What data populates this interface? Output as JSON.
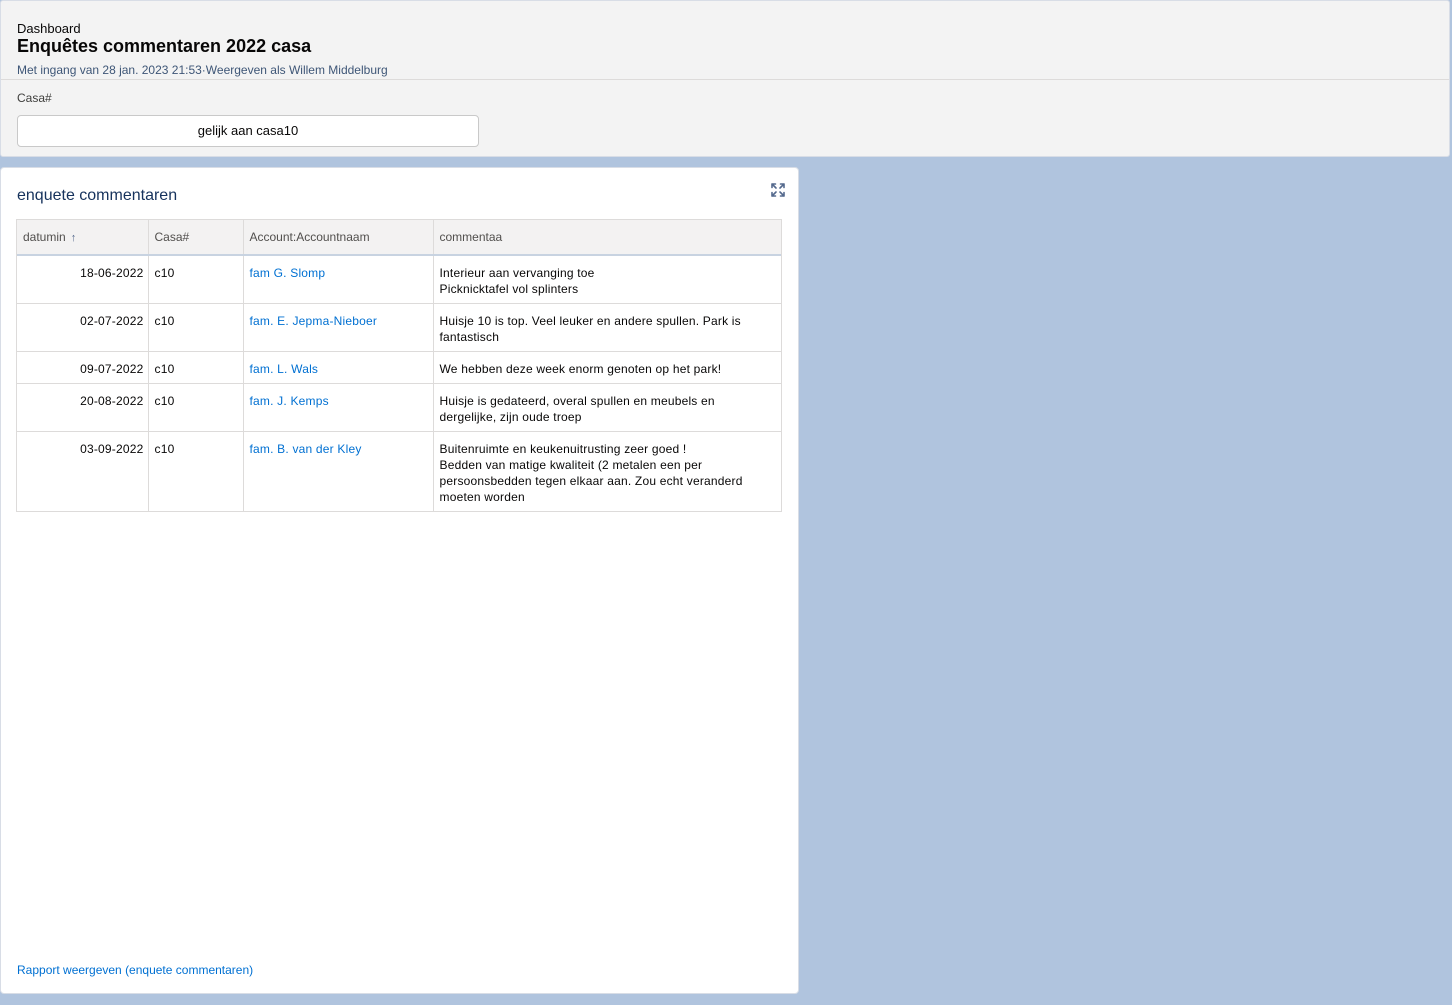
{
  "header": {
    "breadcrumb": "Dashboard",
    "title": "Enquêtes commentaren 2022 casa",
    "subtitle": "Met ingang van 28 jan. 2023 21:53·Weergeven als Willem Middelburg",
    "filter_label": "Casa#",
    "filter_value": "gelijk aan casa10"
  },
  "card": {
    "title": "enquete commentaren",
    "expand_icon": "expand-icon",
    "columns": [
      "datumin",
      "Casa#",
      "Account:Accountnaam",
      "commentaa"
    ],
    "sort_indicator": "↑",
    "rows": [
      {
        "date": "18-06-2022",
        "casa": "c10",
        "account": "fam G. Slomp",
        "comment_lines": [
          "Interieur aan vervanging toe",
          "Picknicktafel vol splinters"
        ]
      },
      {
        "date": "02-07-2022",
        "casa": "c10",
        "account": "fam. E. Jepma-Nieboer",
        "comment_lines": [
          "Huisje 10 is top. Veel leuker en andere spullen. Park is",
          "fantastisch"
        ]
      },
      {
        "date": "09-07-2022",
        "casa": "c10",
        "account": "fam. L. Wals",
        "comment_lines": [
          "We hebben deze week enorm genoten op het park!"
        ]
      },
      {
        "date": "20-08-2022",
        "casa": "c10",
        "account": "fam. J. Kemps",
        "comment_lines": [
          "Huisje is gedateerd, overal spullen en meubels en",
          "dergelijke, zijn oude troep"
        ]
      },
      {
        "date": "03-09-2022",
        "casa": "c10",
        "account": "fam. B. van der Kley",
        "comment_lines": [
          "Buitenruimte en keukenuitrusting zeer goed !",
          "Bedden van matige kwaliteit (2 metalen een per",
          "persoonsbedden tegen elkaar aan. Zou echt veranderd",
          "moeten worden"
        ]
      }
    ],
    "report_link": "Rapport weergeven (enquete commentaren)"
  }
}
